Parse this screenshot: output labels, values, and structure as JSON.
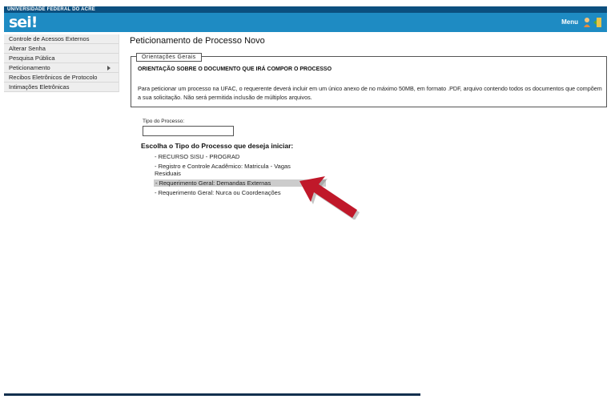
{
  "topbar": {
    "org": "UNIVERSIDADE FEDERAL DO ACRE"
  },
  "header": {
    "logo": "sei!",
    "menu_label": "Menu"
  },
  "sidebar": {
    "items": [
      {
        "label": "Controle de Acessos Externos"
      },
      {
        "label": "Alterar Senha"
      },
      {
        "label": "Pesquisa Pública"
      },
      {
        "label": "Peticionamento"
      },
      {
        "label": "Recibos Eletrônicos de Protocolo"
      },
      {
        "label": "Intimações Eletrônicas"
      }
    ]
  },
  "main": {
    "title": "Peticionamento de Processo Novo",
    "orientacoes": {
      "legend": "Orientações Gerais",
      "heading": "ORIENTAÇÃO SOBRE O DOCUMENTO QUE IRÁ COMPOR O PROCESSO",
      "text": "Para peticionar um processo na UFAC, o requerente deverá incluir em um único anexo de no máximo 50MB, em formato .PDF, arquivo contendo todos os documentos que compõem a sua solicitação. Não será permitida inclusão de múltiplos arquivos."
    },
    "tipo_processo": {
      "label": "Tipo do Processo:",
      "value": ""
    },
    "choose_heading": "Escolha o Tipo do Processo que deseja iniciar:",
    "options": [
      {
        "label": "- RECURSO SISU - PROGRAD"
      },
      {
        "label": "- Registro e Controle Acadêmico: Matricula - Vagas Residuais"
      },
      {
        "label": "- Requerimento Geral: Demandas Externas"
      },
      {
        "label": "- Requerimento Geral: Nurca ou Coordenações"
      }
    ]
  },
  "colors": {
    "header": "#1e8bc3",
    "topbar": "#0b4f7f",
    "arrow": "#c0182a",
    "highlight": "#cccccc"
  }
}
